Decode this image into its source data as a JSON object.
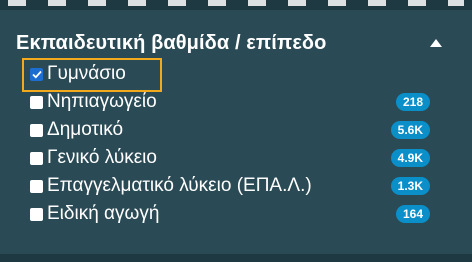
{
  "filter": {
    "title": "Εκπαιδευτική βαθμίδα / επίπεδο",
    "collapse_icon": "caret-up-icon",
    "items": [
      {
        "label": "Γυμνάσιο",
        "checked": true,
        "count": ""
      },
      {
        "label": "Νηπιαγωγείο",
        "checked": false,
        "count": "218"
      },
      {
        "label": "Δημοτικό",
        "checked": false,
        "count": "5.6K"
      },
      {
        "label": "Γενικό λύκειο",
        "checked": false,
        "count": "4.9K"
      },
      {
        "label": "Επαγγελματικό λύκειο (ΕΠΑ.Λ.)",
        "checked": false,
        "count": "1.3K"
      },
      {
        "label": "Ειδική αγωγή",
        "checked": false,
        "count": "164"
      }
    ]
  },
  "colors": {
    "panel_bg": "#2a4a55",
    "badge_bg": "#0b8fc9",
    "checkbox_checked": "#1c6fd1",
    "highlight_border": "#f2a91c"
  }
}
